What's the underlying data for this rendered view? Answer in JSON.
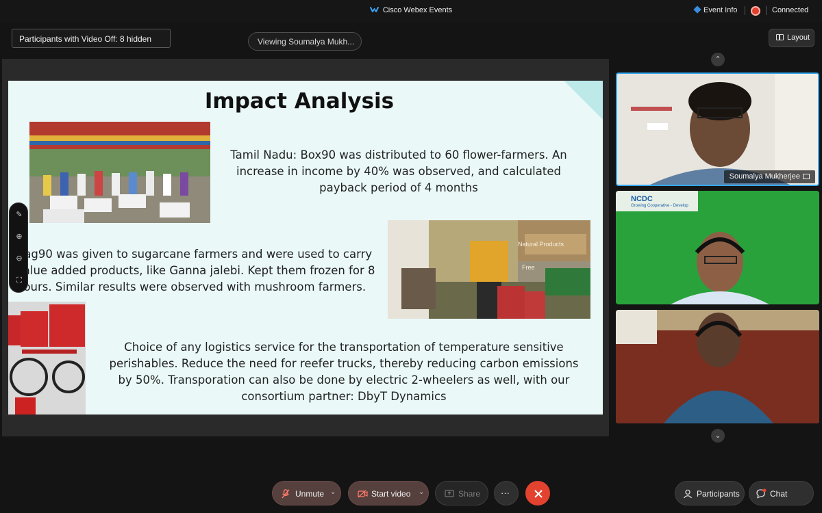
{
  "window": {
    "app_title": "Cisco Webex Events",
    "event_info": "Event Info",
    "connection_status": "Connected"
  },
  "top_controls": {
    "hidden_participants": "Participants with Video Off:  8 hidden",
    "viewing": "Viewing Soumalya Mukh...",
    "layout_label": "Layout"
  },
  "slide": {
    "title": "Impact Analysis",
    "paragraph_1": "Tamil Nadu: Box90 was distributed to 60 flower-farmers. An increase in income by 40% was observed, and  calculated payback period of 4 months",
    "paragraph_2": "Bag90 was given to sugarcane farmers and were used to carry value added products, like Ganna jalebi. Kept them frozen for 8 hours. Similar results were observed with mushroom farmers.",
    "paragraph_3": "Choice of any logistics service for the transportation of temperature sensitive perishables. Reduce the need for reefer trucks, thereby reducing carbon emissions by 50%. Transporation can also be done by electric 2-wheelers as well, with our consortium partner: DbyT Dynamics",
    "photo2_text": "Natural Products",
    "photo2_text_2": "Free"
  },
  "participants_panel": {
    "active_speaker_name": "Soumalya Mukherjee",
    "ncdc_logo_text": "NCDC",
    "ncdc_logo_subtext": "Growing Cooperative - Develop"
  },
  "bottom_bar": {
    "unmute_label": "Unmute",
    "start_video_label": "Start video",
    "share_label": "Share",
    "more_label": "···",
    "participants_label": "Participants",
    "chat_label": "Chat"
  },
  "colors": {
    "accent_blue": "#35a7ee",
    "end_call_red": "#e3422f",
    "recording_red": "#e0402f",
    "slide_background": "#eaf8f8"
  }
}
